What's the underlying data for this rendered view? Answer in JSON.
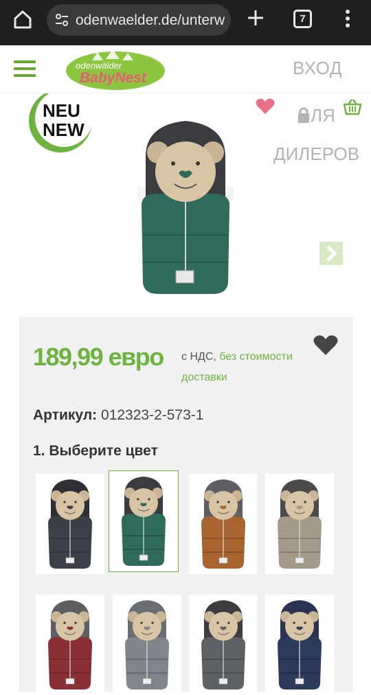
{
  "browser": {
    "url": "odenwaelder.de/unterw",
    "tab_count": "7"
  },
  "header": {
    "logo_text_top": "odenwälder",
    "logo_text_bottom": "BabyNest",
    "login_label": "ВХОД"
  },
  "product": {
    "badge_line1": "NEU",
    "badge_line2": "NEW",
    "dealer_label_part1": "ЛЯ",
    "dealer_label_part2": "ДИЛЕРОВ"
  },
  "details": {
    "price": "189,99 евро",
    "tax_prefix": "с НДС,",
    "shipping_link": "без стоимости доставки",
    "article_label": "Артикул:",
    "article_value": "012323-2-573-1",
    "choose_color": "1. Выберите цвет"
  },
  "colors": {
    "accent": "#6db33f",
    "swatches": [
      {
        "name": "anthracite",
        "body": "#3d4047",
        "hood": "#2f3035"
      },
      {
        "name": "green",
        "body": "#2f6b5c",
        "hood": "#3b3c40"
      },
      {
        "name": "brown",
        "body": "#a8642e",
        "hood": "#5e5f63"
      },
      {
        "name": "beige",
        "body": "#a39a8a",
        "hood": "#4b4b4e"
      },
      {
        "name": "red",
        "body": "#8a2f35",
        "hood": "#5e5f63"
      },
      {
        "name": "grey",
        "body": "#7f858b",
        "hood": "#6a6d72"
      },
      {
        "name": "dark-grey",
        "body": "#5d6166",
        "hood": "#3c3d41"
      },
      {
        "name": "navy",
        "body": "#2c3a5c",
        "hood": "#2a3352"
      }
    ]
  }
}
